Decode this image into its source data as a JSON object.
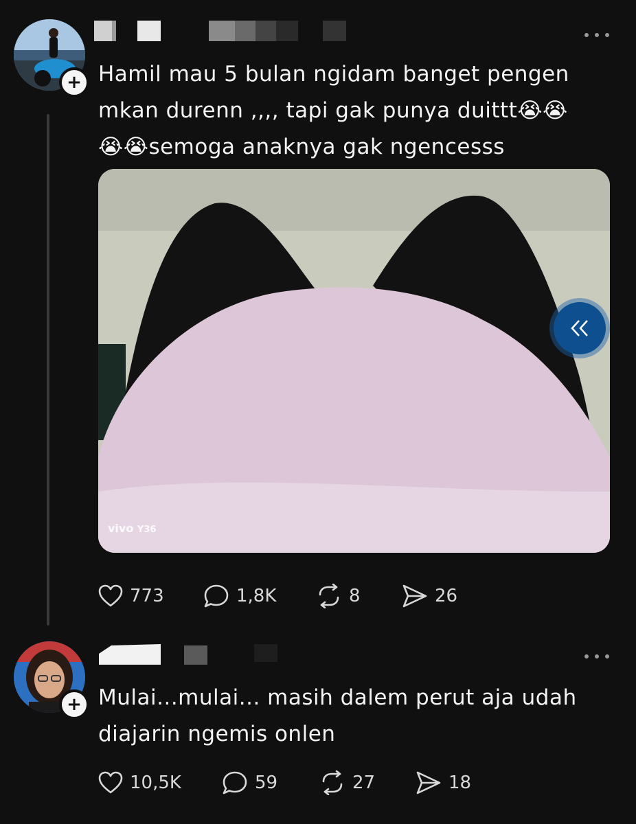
{
  "posts": [
    {
      "text_lines": [
        "Hamil mau 5 bulan ngidam banget pengen",
        "mkan durenn ,,,, tapi gak punya duittt😭😭",
        "😭😭semoga anaknya gak ngencesss"
      ],
      "media": {
        "watermark_brand": "vivo",
        "watermark_model": "Y36"
      },
      "stats": {
        "likes": "773",
        "replies": "1,8K",
        "reposts": "8",
        "shares": "26"
      }
    },
    {
      "text_lines": [
        "Mulai...mulai... masih dalem perut aja udah",
        "diajarin ngemis onlen"
      ],
      "stats": {
        "likes": "10,5K",
        "replies": "59",
        "reposts": "27",
        "shares": "18"
      }
    }
  ],
  "follow_symbol": "+",
  "icons": {
    "like": "heart-icon",
    "reply": "comment-bubble-icon",
    "repost": "repost-icon",
    "share": "send-icon",
    "more": "more-dots-icon",
    "carousel": "double-chevron-left-icon"
  },
  "colors": {
    "background": "#101010",
    "text": "#f3f3f3",
    "meta": "#d8d8d8",
    "accent": "#0d4f8f"
  }
}
